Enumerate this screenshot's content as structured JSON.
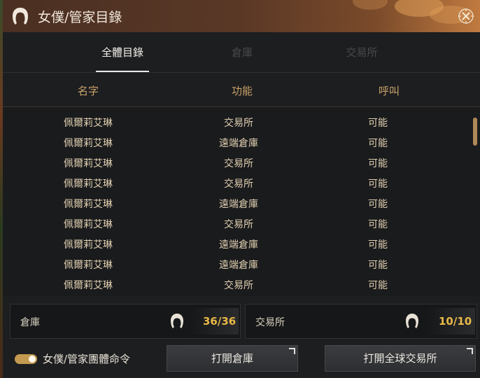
{
  "window": {
    "title": "女僕/管家目錄"
  },
  "tabs": [
    {
      "label": "全體目錄",
      "active": true
    },
    {
      "label": "倉庫",
      "active": false
    },
    {
      "label": "交易所",
      "active": false
    }
  ],
  "columns": {
    "name": "名字",
    "function": "功能",
    "call": "呼叫"
  },
  "rows": [
    {
      "name": "佩爾莉艾琳",
      "function": "交易所",
      "call": "可能"
    },
    {
      "name": "佩爾莉艾琳",
      "function": "遠端倉庫",
      "call": "可能"
    },
    {
      "name": "佩爾莉艾琳",
      "function": "交易所",
      "call": "可能"
    },
    {
      "name": "佩爾莉艾琳",
      "function": "交易所",
      "call": "可能"
    },
    {
      "name": "佩爾莉艾琳",
      "function": "遠端倉庫",
      "call": "可能"
    },
    {
      "name": "佩爾莉艾琳",
      "function": "交易所",
      "call": "可能"
    },
    {
      "name": "佩爾莉艾琳",
      "function": "遠端倉庫",
      "call": "可能"
    },
    {
      "name": "佩爾莉艾琳",
      "function": "遠端倉庫",
      "call": "可能"
    },
    {
      "name": "佩爾莉艾琳",
      "function": "交易所",
      "call": "可能"
    }
  ],
  "counters": {
    "warehouse": {
      "label": "倉庫",
      "count": "36/36"
    },
    "market": {
      "label": "交易所",
      "count": "10/10"
    }
  },
  "footer": {
    "group_command_label": "女僕/管家團體命令",
    "group_command_on": true,
    "open_warehouse_label": "打開倉庫",
    "open_market_label": "打開全球交易所"
  },
  "icons": {
    "title": "maid-head-icon",
    "close": "close-icon",
    "counter": "maid-head-icon",
    "external": "external-link-icon"
  },
  "colors": {
    "accent_gold": "#e8b848",
    "header_text": "#c8a26a",
    "toggle_on": "#c49a50"
  }
}
